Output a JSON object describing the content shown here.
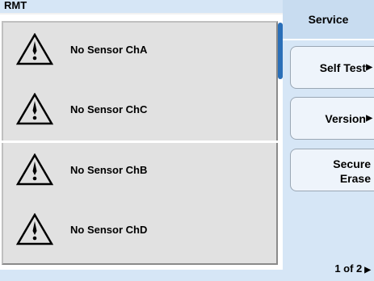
{
  "status_bar": {
    "mode": "RMT"
  },
  "channels": [
    {
      "message": "No Sensor ChA",
      "icon": "warning-triangle-icon"
    },
    {
      "message": "No Sensor ChC",
      "icon": "warning-triangle-icon"
    },
    {
      "message": "No Sensor ChB",
      "icon": "warning-triangle-icon"
    },
    {
      "message": "No Sensor ChD",
      "icon": "warning-triangle-icon"
    }
  ],
  "softkeys": {
    "title": "Service",
    "self_test": "Self Test",
    "version": "Version",
    "secure_erase_line1": "Secure",
    "secure_erase_line2": "Erase",
    "arrow": "▶",
    "page": "1 of 2"
  },
  "colors": {
    "panel_bg": "#d6e6f6",
    "window_bg": "#e1e1e1",
    "accent": "#2a6fb8"
  }
}
